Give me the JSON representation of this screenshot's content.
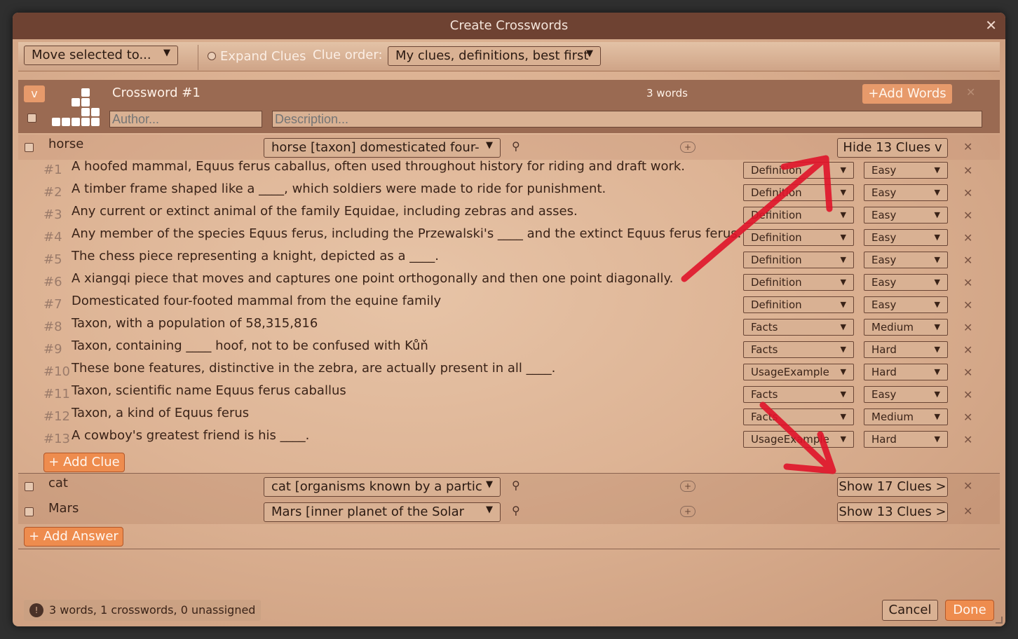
{
  "window": {
    "title": "Create Crosswords"
  },
  "toolbar": {
    "move_selected": "Move selected to...",
    "expand_clues": "Expand Clues",
    "clue_order_label": "Clue order:",
    "clue_order_value": "My clues, definitions, best first"
  },
  "crossword": {
    "toggle": "v",
    "title": "Crossword #1",
    "word_count": "3 words",
    "add_words": "+Add Words",
    "author_placeholder": "Author...",
    "description_placeholder": "Description..."
  },
  "words": [
    {
      "word": "horse",
      "sense": "horse [taxon] domesticated four-",
      "clues_button": "Hide 13 Clues v"
    },
    {
      "word": "cat",
      "sense": "cat [organisms known by a partic",
      "clues_button": "Show 17 Clues >"
    },
    {
      "word": "Mars",
      "sense": "Mars [inner planet of the Solar",
      "clues_button": "Show 13 Clues >"
    }
  ],
  "clues": [
    {
      "num": "#1",
      "text": "A hoofed mammal, Equus ferus caballus, often used throughout history for riding and draft work.",
      "type": "Definition",
      "difficulty": "Easy"
    },
    {
      "num": "#2",
      "text": "A timber frame shaped like a ____, which soldiers were made to ride for punishment.",
      "type": "Definition",
      "difficulty": "Easy"
    },
    {
      "num": "#3",
      "text": "Any current or extinct animal of the family Equidae, including zebras and asses.",
      "type": "Definition",
      "difficulty": "Easy"
    },
    {
      "num": "#4",
      "text": "Any member of the species Equus ferus, including the Przewalski's ____ and the extinct Equus ferus ferus.",
      "type": "Definition",
      "difficulty": "Easy"
    },
    {
      "num": "#5",
      "text": "The chess piece representing a knight, depicted as a ____.",
      "type": "Definition",
      "difficulty": "Easy"
    },
    {
      "num": "#6",
      "text": "A xiangqi piece that moves and captures one point orthogonally and then one point diagonally.",
      "type": "Definition",
      "difficulty": "Easy"
    },
    {
      "num": "#7",
      "text": "Domesticated four-footed mammal from the equine family",
      "type": "Definition",
      "difficulty": "Easy"
    },
    {
      "num": "#8",
      "text": "Taxon, with a population of 58,315,816",
      "type": "Facts",
      "difficulty": "Medium"
    },
    {
      "num": "#9",
      "text": "Taxon, containing ____ hoof, not to be confused with Kůň",
      "type": "Facts",
      "difficulty": "Hard"
    },
    {
      "num": "#10",
      "text": "These bone features, distinctive in the zebra, are actually present in all ____.",
      "type": "UsageExample",
      "difficulty": "Hard"
    },
    {
      "num": "#11",
      "text": "Taxon, scientific name Equus ferus caballus",
      "type": "Facts",
      "difficulty": "Easy"
    },
    {
      "num": "#12",
      "text": "Taxon, a kind of Equus ferus",
      "type": "Facts",
      "difficulty": "Medium"
    },
    {
      "num": "#13",
      "text": "A cowboy's greatest friend is his ____.",
      "type": "UsageExample",
      "difficulty": "Hard"
    }
  ],
  "add_clue": "+ Add Clue",
  "add_answer": "+ Add Answer",
  "status": {
    "text": "3 words, 1 crosswords, 0 unassigned",
    "icon": "!"
  },
  "footer": {
    "cancel": "Cancel",
    "done": "Done"
  },
  "colors": {
    "titlebar": "#6e4232",
    "accent": "#ee8c4e",
    "annotation_arrow": "#e0142a"
  }
}
